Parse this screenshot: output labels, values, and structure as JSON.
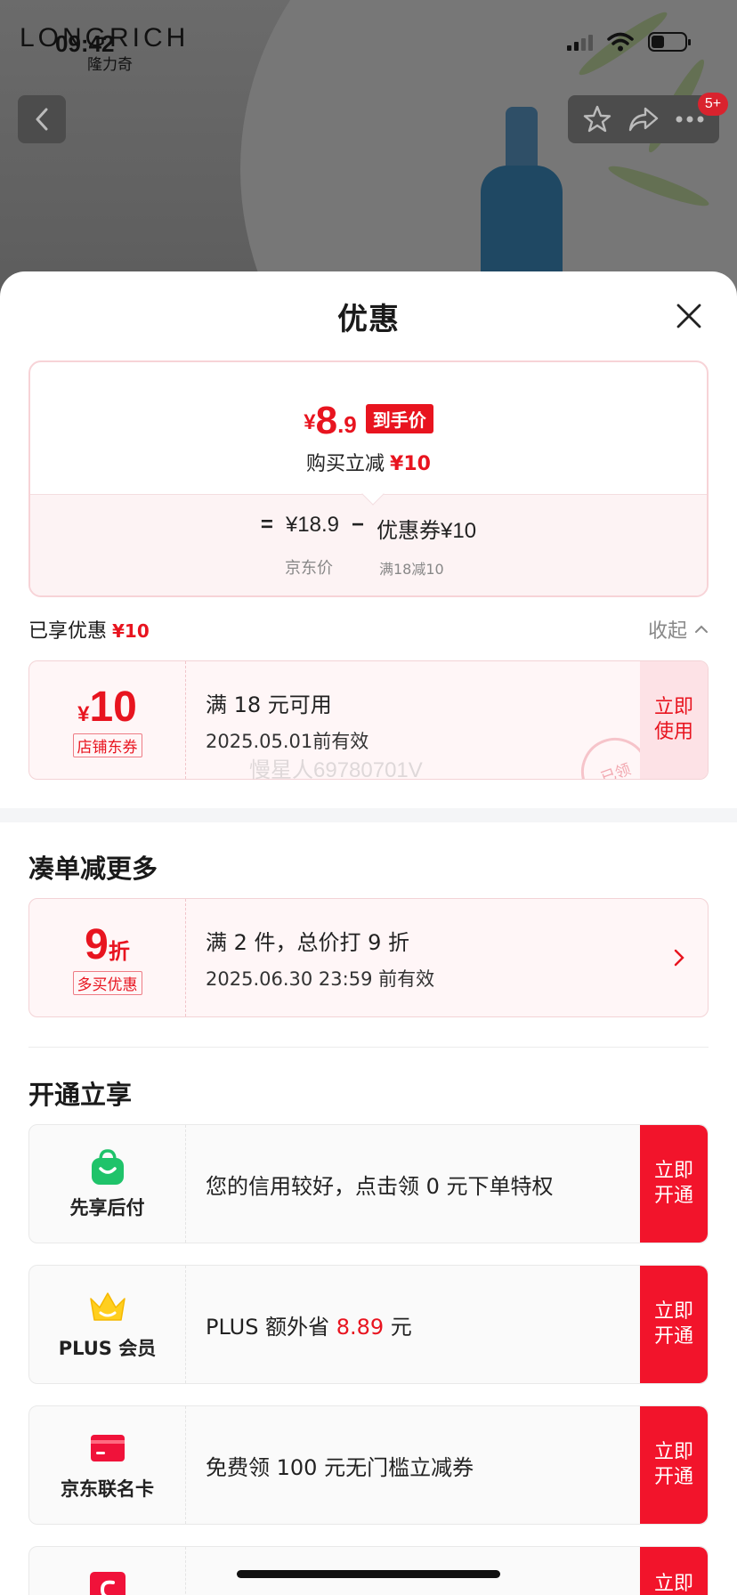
{
  "background": {
    "status_time": "09:42",
    "brand_en": "LONGRICH",
    "brand_cn": "隆力奇",
    "cart_badge": "5+"
  },
  "sheet": {
    "title": "优惠",
    "price_summary": {
      "currency": "¥",
      "final_int": "8",
      "final_dec": ".9",
      "final_tag": "到手价",
      "reduce_label": "购买立减",
      "reduce_amount": "¥10",
      "eq": "=",
      "jd_price": "¥18.9",
      "minus": "−",
      "coupon_part": "优惠券¥10",
      "jd_price_label": "京东价",
      "coupon_rule": "满18减10"
    },
    "enjoyed": {
      "label": "已享优惠",
      "amount": "¥10",
      "collapse": "收起"
    },
    "store_coupon": {
      "currency": "¥",
      "amount": "10",
      "tag": "店铺东券",
      "condition": "满 18 元可用",
      "validity": "2025.05.01前有效",
      "action": "立即\n使用",
      "stamp": "已领",
      "watermark": "慢星人69780701V"
    },
    "more_section": {
      "title": "凑单减更多",
      "discount_value": "9",
      "discount_unit": "折",
      "tag": "多买优惠",
      "condition": "满 2 件，总价打 9 折",
      "validity": "2025.06.30 23:59 前有效"
    },
    "open_section": {
      "title": "开通立享",
      "items": [
        {
          "label": "先享后付",
          "text_a": "您的信用较好，点击领 0 元下单特权",
          "text_hl": "",
          "text_b": "",
          "action": "立即\n开通",
          "icon": "shopping-bag-icon"
        },
        {
          "label": "PLUS 会员",
          "text_a": "PLUS 额外省 ",
          "text_hl": "8.89",
          "text_b": " 元",
          "action": "立即\n开通",
          "icon": "crown-icon"
        },
        {
          "label": "京东联名卡",
          "text_a": "免费领 100 元无门槛立减券",
          "text_hl": "",
          "text_b": "",
          "action": "立即\n开通",
          "icon": "credit-card-icon"
        },
        {
          "label": "",
          "text_a": "",
          "text_hl": "",
          "text_b": "",
          "action": "立即",
          "icon": "coupon-icon"
        }
      ]
    }
  },
  "colors": {
    "accent_red": "#e8141f",
    "open_btn": "#f2142b"
  }
}
